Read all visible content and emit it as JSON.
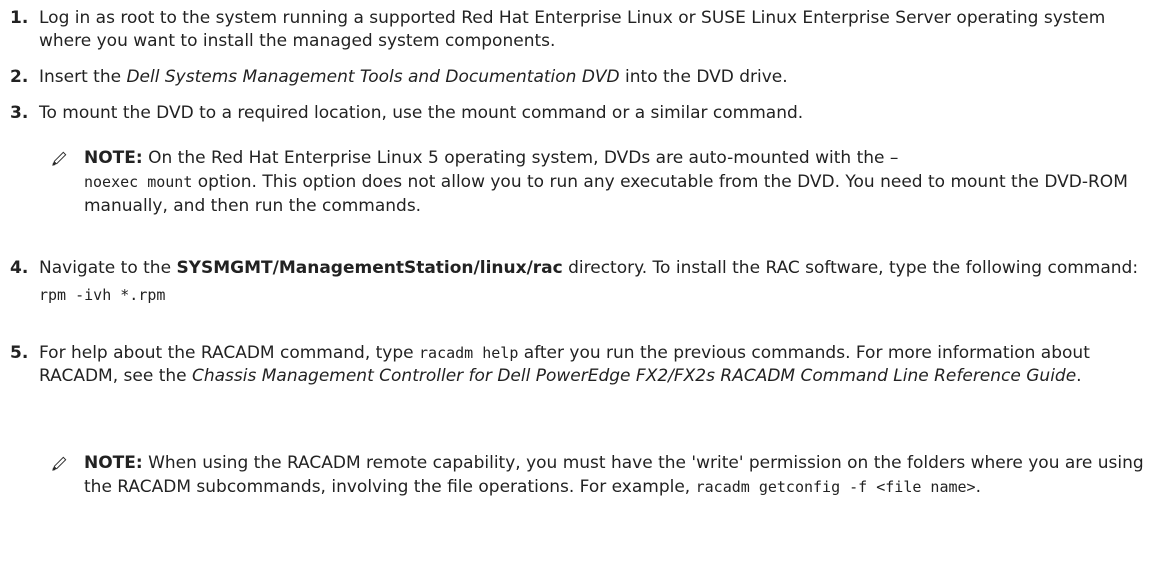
{
  "steps": [
    {
      "number": "1.",
      "text": "Log in as root to the system running a supported Red Hat Enterprise Linux or SUSE Linux Enterprise Server operating system where you want to install the managed system components."
    },
    {
      "number": "2.",
      "pre": "Insert the ",
      "em": "Dell Systems Management Tools and Documentation DVD",
      "post": " into the DVD drive."
    },
    {
      "number": "3.",
      "text": "To mount the DVD to a required location, use the mount command or a similar command."
    },
    {
      "number": "4.",
      "pre": "Navigate to the ",
      "strong": "SYSMGMT/ManagementStation/linux/rac",
      "post": " directory. To install the RAC software, type the following command:",
      "command": "rpm -ivh *.rpm"
    },
    {
      "number": "5.",
      "pre": "For help about the RACADM command, type ",
      "code": "racadm help",
      "mid": " after you run the previous commands. For more information about RACADM, see the ",
      "em": "Chassis Management Controller for Dell PowerEdge FX2/FX2s RACADM Command Line Reference Guide",
      "post": "."
    }
  ],
  "notes": [
    {
      "label": "NOTE:",
      "pre": " On the Red Hat Enterprise Linux 5 operating system, DVDs are auto-mounted with the –",
      "code": "noexec mount",
      "post": " option. This option does not allow you to run any executable from the DVD. You need to mount the DVD-ROM manually, and then run the commands."
    },
    {
      "label": "NOTE:",
      "pre": " When using the RACADM remote capability, you must have the 'write' permission on the folders where you are using the RACADM subcommands, involving the file operations. For example, ",
      "code": "racadm getconfig -f <file name>",
      "post": "."
    }
  ],
  "icons": {
    "note": "pencil-icon"
  }
}
